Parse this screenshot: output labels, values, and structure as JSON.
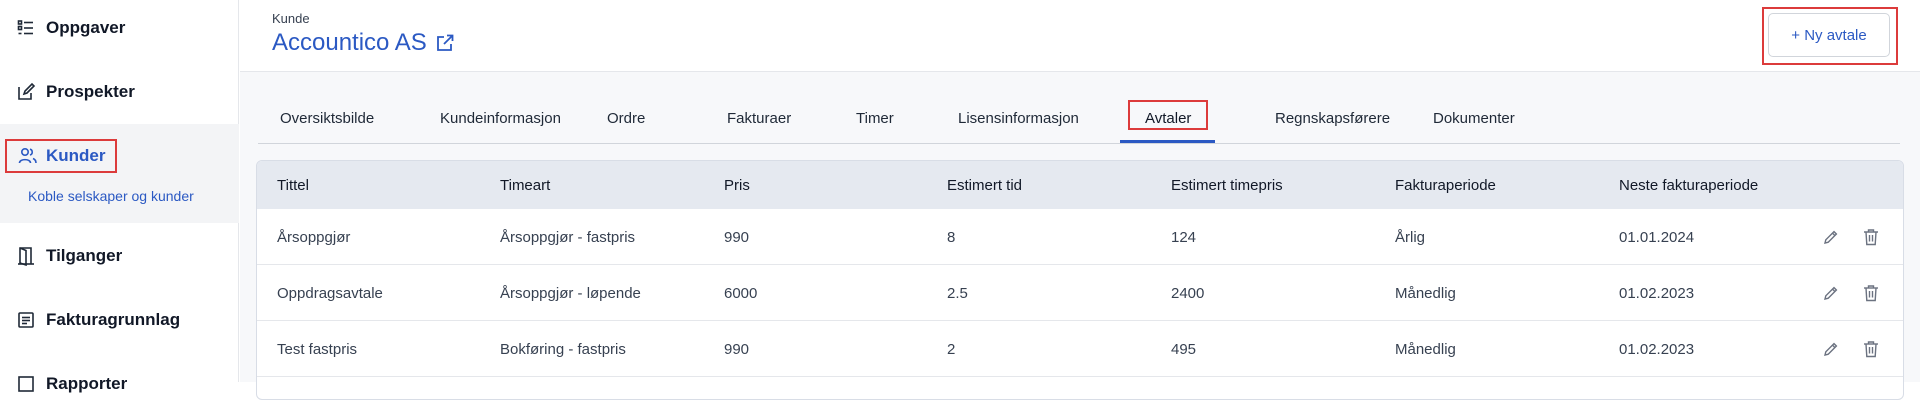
{
  "sidebar": {
    "items": [
      {
        "label": "Oppgaver",
        "icon": "task-list-icon"
      },
      {
        "label": "Prospekter",
        "icon": "edit-document-icon"
      },
      {
        "label": "Kunder",
        "icon": "users-icon"
      },
      {
        "label": "Tilganger",
        "icon": "door-icon"
      },
      {
        "label": "Fakturagrunnlag",
        "icon": "invoice-icon"
      },
      {
        "label": "Rapporter",
        "icon": "report-icon"
      }
    ],
    "sub_item": "Koble selskaper og kunder"
  },
  "header": {
    "section_label": "Kunde",
    "company_name": "Accountico AS",
    "new_button": "+ Ny avtale"
  },
  "tabs": [
    {
      "label": "Oversiktsbilde"
    },
    {
      "label": "Kundeinformasjon"
    },
    {
      "label": "Ordre"
    },
    {
      "label": "Fakturaer"
    },
    {
      "label": "Timer"
    },
    {
      "label": "Lisensinformasjon"
    },
    {
      "label": "Avtaler",
      "active": true
    },
    {
      "label": "Regnskapsførere"
    },
    {
      "label": "Dokumenter"
    }
  ],
  "table": {
    "columns": [
      "Tittel",
      "Timeart",
      "Pris",
      "Estimert tid",
      "Estimert timepris",
      "Fakturaperiode",
      "Neste fakturaperiode"
    ],
    "rows": [
      [
        "Årsoppgjør",
        "Årsoppgjør - fastpris",
        "990",
        "8",
        "124",
        "Årlig",
        "01.01.2024"
      ],
      [
        "Oppdragsavtale",
        "Årsoppgjør - løpende",
        "6000",
        "2.5",
        "2400",
        "Månedlig",
        "01.02.2023"
      ],
      [
        "Test fastpris",
        "Bokføring - fastpris",
        "990",
        "2",
        "495",
        "Månedlig",
        "01.02.2023"
      ]
    ]
  },
  "colors": {
    "accent": "#2b59c3",
    "highlight": "#dc3b3b",
    "table_header_bg": "#e5e9f0"
  }
}
